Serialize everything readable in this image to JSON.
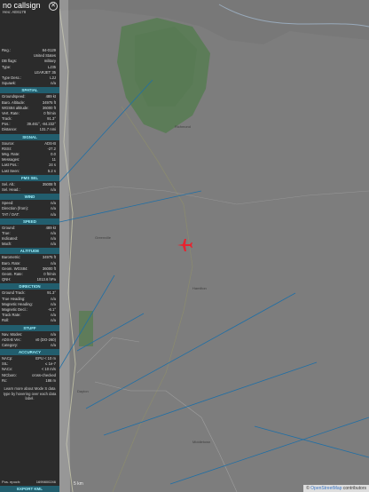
{
  "aircraft": {
    "callsign": "no callsign",
    "close_glyph": "✕",
    "hex_text": "Hex:  AE6178"
  },
  "info_rows": [
    {
      "k": "Reg.:",
      "v": "84-0129"
    },
    {
      "k": "",
      "v": "United States"
    },
    {
      "k": "DB flags:",
      "v": "military"
    },
    {
      "k": "Type:",
      "v": "LJ35"
    },
    {
      "k": "",
      "v": "LEARJET 35"
    },
    {
      "k": "Type Desc.:",
      "v": "L2J"
    },
    {
      "k": "Squawk:",
      "v": "n/a"
    }
  ],
  "sections": [
    {
      "title": "SPATIAL",
      "rows": [
        {
          "k": "Groundspeed:",
          "v": "489 kt"
        },
        {
          "k": "Baro. Altitude:",
          "v": "34975 ft"
        },
        {
          "k": "WGS84 altitude:",
          "v": "36000 ft"
        },
        {
          "k": "Vert. Rate:",
          "v": "0 ft/min"
        },
        {
          "k": "Track:",
          "v": "91.3°"
        },
        {
          "k": "Pos.:",
          "v": "39.461°, -84.232°"
        },
        {
          "k": "Distance:",
          "v": "131.7 nmi"
        }
      ]
    },
    {
      "title": "SIGNAL",
      "rows": [
        {
          "k": "Source:",
          "v": "ADS-B"
        },
        {
          "k": "RSSI:",
          "v": "-27.2"
        },
        {
          "k": "Msg. Rate:",
          "v": "0.0"
        },
        {
          "k": "Messages:",
          "v": "11"
        },
        {
          "k": "Last Pos.:",
          "v": "24 s"
        },
        {
          "k": "Last Seen:",
          "v": "5.2 s"
        }
      ]
    },
    {
      "title": "FMS SEL",
      "rows": [
        {
          "k": "Sel. Alt.:",
          "v": "35008 ft"
        },
        {
          "k": "Sel. Head.:",
          "v": "n/a"
        }
      ]
    },
    {
      "title": "WIND",
      "rows": [
        {
          "k": "Speed:",
          "v": "n/a"
        },
        {
          "k": "Direction (from):",
          "v": "n/a"
        },
        {
          "k": "TAT / OAT:",
          "v": "n/a"
        }
      ]
    },
    {
      "title": "SPEED",
      "rows": [
        {
          "k": "Ground:",
          "v": "489 kt"
        },
        {
          "k": "True:",
          "v": "n/a"
        },
        {
          "k": "Indicated:",
          "v": "n/a"
        },
        {
          "k": "Mach:",
          "v": "n/a"
        }
      ]
    },
    {
      "title": "ALTITUDE",
      "rows": [
        {
          "k": "Barometric:",
          "v": "34975 ft"
        },
        {
          "k": "Baro. Rate:",
          "v": "n/a"
        },
        {
          "k": "Geom. WGS84:",
          "v": "36000 ft"
        },
        {
          "k": "Geom. Rate:",
          "v": "0 ft/min"
        },
        {
          "k": "QNH:",
          "v": "1013.6 hPa"
        }
      ]
    },
    {
      "title": "DIRECTION",
      "rows": [
        {
          "k": "Ground Track:",
          "v": "91.3°"
        },
        {
          "k": "True Heading:",
          "v": "n/a"
        },
        {
          "k": "Magnetic Heading:",
          "v": "n/a"
        },
        {
          "k": "Magnetic Decl.:",
          "v": "-6.1°"
        },
        {
          "k": "Track Rate:",
          "v": "n/a"
        },
        {
          "k": "Roll:",
          "v": "n/a"
        }
      ]
    },
    {
      "title": "STUFF",
      "rows": [
        {
          "k": "Nav. Modes:",
          "v": "n/a"
        },
        {
          "k": "ADS-B Ver.:",
          "v": "v0 (DO-260)"
        },
        {
          "k": "Category:",
          "v": "n/a"
        }
      ]
    },
    {
      "title": "ACCURACY",
      "rows": [
        {
          "k": "NACp:",
          "v": "EPU < 10 m"
        },
        {
          "k": "SIL:",
          "v": "≤ 1e-7"
        },
        {
          "k": "NACv:",
          "v": "< 10 m/s"
        },
        {
          "k": "NICbaro:",
          "v": "cross-checked"
        },
        {
          "k": "Rc:",
          "v": "186 m"
        }
      ]
    }
  ],
  "accuracy_note": "Learn more about Mode S data type by hovering over each data label.",
  "pos_epoch": {
    "k": "Pos. epoch:",
    "v": "1699800246"
  },
  "export_label": "EXPORT KML",
  "map": {
    "scale_text": "5 km",
    "attribution_prefix": "© ",
    "attribution_link": "OpenStreetMap",
    "attribution_suffix": " contributors",
    "aircraft_color": "#e8232f",
    "track_color": "#1f6fa6",
    "labels": [
      "Richmond",
      "Greenville",
      "Hamilton",
      "Dayton",
      "Middletown"
    ]
  }
}
